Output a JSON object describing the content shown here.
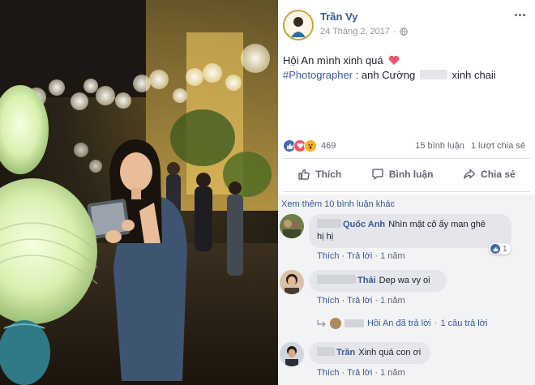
{
  "post": {
    "author": "Trần Vy",
    "date": "24 Tháng 2, 2017",
    "caption_line1": "Hội An mình xinh quá",
    "hashtag": "#Photographer",
    "caption_line2_pre": ": anh Cường",
    "caption_line2_post": "xinh chaii"
  },
  "reactions": {
    "count": "469",
    "comments": "15 bình luận",
    "shares": "1 lượt chia sẻ"
  },
  "actions": {
    "like": "Thích",
    "comment": "Bình luận",
    "share": "Chia sẻ"
  },
  "comments_section": {
    "see_more": "Xem thêm 10 bình luận khác",
    "items": [
      {
        "name": "Quốc Anh",
        "text": "Nhìn mặt cô ấy man ghê",
        "text2": "hị hị",
        "like": "Thích",
        "reply": "Trả lời",
        "time": "1 năm",
        "like_count": "1"
      },
      {
        "name": "Thái",
        "text": "Dep wa vy oi",
        "like": "Thích",
        "reply": "Trả lời",
        "time": "1 năm",
        "replied_text": "Hồi An đã trả lời",
        "replies_count": "1 câu trả lời"
      },
      {
        "name": "Trần",
        "text": "Xinh quá con ơi",
        "like": "Thích",
        "reply": "Trả lời",
        "time": "1 năm"
      }
    ]
  },
  "colors": {
    "link_blue": "#385898",
    "like_blue": "#4267b2",
    "love_red": "#f25268",
    "wow_yellow": "#f7b125",
    "comment_bg": "#f2f3f5"
  },
  "icons": [
    "globe-icon",
    "more-options-icon",
    "heart-emoji-icon",
    "like-icon",
    "comment-icon",
    "share-icon"
  ]
}
